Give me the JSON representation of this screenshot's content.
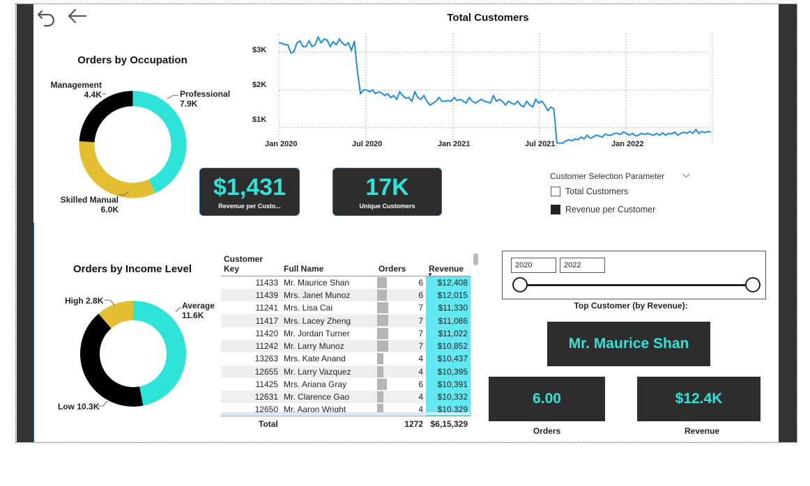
{
  "colors": {
    "teal": "#2ee3d8",
    "yellow": "#e3bd32",
    "black": "#000000",
    "line": "#1e8be6",
    "dark": "#2d2d2d"
  },
  "nav": {
    "undo_icon": "undo-icon",
    "back_icon": "arrow-left-icon"
  },
  "occupation": {
    "title": "Orders by Occupation",
    "labels": [
      {
        "name": "Management",
        "value": "4.4K"
      },
      {
        "name": "Professional",
        "value": "7.9K"
      },
      {
        "name": "Skilled Manual",
        "value": "6.0K"
      }
    ]
  },
  "income": {
    "title": "Orders by Income Level",
    "labels": [
      {
        "name": "High",
        "value": "2.8K"
      },
      {
        "name": "Average",
        "value": "11.6K"
      },
      {
        "name": "Low",
        "value": "10.3K"
      }
    ]
  },
  "line": {
    "title": "Total Customers",
    "yticks": [
      "$3K",
      "$2K",
      "$1K"
    ],
    "xticks": [
      "Jan 2020",
      "Jul 2020",
      "Jan 2021",
      "Jul 2021",
      "Jan 2022"
    ]
  },
  "kpis": {
    "revenue_value": "$1,431",
    "revenue_label": "Revenue per Custo...",
    "unique_value": "17K",
    "unique_label": "Unique Customers"
  },
  "param": {
    "title": "Customer Selection Parameter",
    "options": [
      "Total Customers",
      "Revenue per Customer"
    ],
    "selected": "Revenue per Customer"
  },
  "table": {
    "headers": [
      "Customer Key",
      "Full Name",
      "Orders",
      "Revenue"
    ],
    "rows": [
      [
        "11433",
        "Mr. Maurice Shan",
        "6",
        "$12,408"
      ],
      [
        "11439",
        "Mrs. Janet Munoz",
        "6",
        "$12,015"
      ],
      [
        "11241",
        "Mrs. Lisa Cai",
        "7",
        "$11,330"
      ],
      [
        "11417",
        "Mrs. Lacey Zheng",
        "7",
        "$11,086"
      ],
      [
        "11420",
        "Mr. Jordan Turner",
        "7",
        "$11,022"
      ],
      [
        "11242",
        "Mr. Larry Munoz",
        "7",
        "$10,852"
      ],
      [
        "13263",
        "Mrs. Kate Anand",
        "4",
        "$10,437"
      ],
      [
        "12655",
        "Mr. Larry Vazquez",
        "4",
        "$10,395"
      ],
      [
        "11425",
        "Mrs. Ariana Gray",
        "6",
        "$10,391"
      ],
      [
        "12631",
        "Mr. Clarence Gao",
        "4",
        "$10,332"
      ],
      [
        "12650",
        "Mr. Aaron Wright",
        "4",
        "$10,329"
      ]
    ],
    "total_label": "Total",
    "total_orders": "1272",
    "total_revenue": "$6,15,329"
  },
  "slicer": {
    "from": "2020",
    "to": "2022"
  },
  "top": {
    "caption": "Top Customer (by Revenue):",
    "name": "Mr. Maurice Shan",
    "orders_value": "6.00",
    "orders_label": "Orders",
    "revenue_value": "$12.4K",
    "revenue_label": "Revenue"
  },
  "chart_data": [
    {
      "type": "pie",
      "title": "Orders by Occupation",
      "categories": [
        "Professional",
        "Skilled Manual",
        "Management"
      ],
      "values": [
        7900,
        6000,
        4400
      ],
      "colors": [
        "#2ee3d8",
        "#e3bd32",
        "#000000"
      ]
    },
    {
      "type": "pie",
      "title": "Orders by Income Level",
      "categories": [
        "Average",
        "Low",
        "High"
      ],
      "values": [
        11600,
        10300,
        2800
      ],
      "colors": [
        "#2ee3d8",
        "#000000",
        "#e3bd32"
      ]
    },
    {
      "type": "line",
      "title": "Total Customers",
      "x_range": [
        "Jan 2020",
        "Apr 2022"
      ],
      "ylim": [
        600,
        3500
      ],
      "grid": true,
      "values": [
        3250,
        3240,
        3200,
        3200,
        2980,
        3020,
        3250,
        3300,
        3150,
        3150,
        3300,
        3150,
        3200,
        3400,
        3250,
        3350,
        3320,
        3150,
        3280,
        3200,
        3350,
        3250,
        3180,
        3250,
        3050,
        3300,
        2500,
        1900,
        2000,
        2000,
        1950,
        2000,
        1900,
        1950,
        1920,
        1850,
        1900,
        1800,
        1850,
        1750,
        1950,
        1850,
        1780,
        1800,
        1700,
        1950,
        1800,
        1750,
        1850,
        1700,
        1600,
        1650,
        1700,
        1800,
        1700,
        1700,
        1720,
        1700,
        1800,
        1720,
        1750,
        1700,
        1650,
        1800,
        1700,
        1650,
        1700,
        1750,
        1700,
        1680,
        1650,
        1850,
        1700,
        1750,
        1700,
        1600,
        1700,
        1650,
        1620,
        1700,
        1600,
        1550,
        1700,
        1600,
        1550,
        1750,
        1650,
        1700,
        1600,
        1450,
        1550,
        1500,
        590,
        590,
        590,
        650,
        680,
        650,
        700,
        680,
        750,
        700,
        800,
        720,
        750,
        800,
        780,
        750,
        830,
        800,
        800,
        850,
        850,
        820,
        880,
        850,
        800,
        850,
        780,
        800,
        850,
        820,
        850,
        820,
        800,
        850,
        800,
        860,
        800,
        850,
        830,
        880,
        800,
        850,
        880,
        850,
        900,
        850,
        950,
        850,
        900,
        870,
        900,
        880
      ]
    }
  ]
}
